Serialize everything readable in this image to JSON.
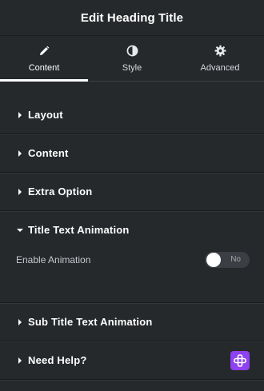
{
  "header": {
    "title": "Edit Heading Title"
  },
  "tabs": [
    {
      "label": "Content",
      "icon": "pencil-icon",
      "active": true
    },
    {
      "label": "Style",
      "icon": "half-circle-icon",
      "active": false
    },
    {
      "label": "Advanced",
      "icon": "gear-icon",
      "active": false
    }
  ],
  "sections": {
    "layout": {
      "title": "Layout",
      "expanded": false
    },
    "content": {
      "title": "Content",
      "expanded": false
    },
    "extra": {
      "title": "Extra Option",
      "expanded": false
    },
    "title_anim": {
      "title": "Title Text Animation",
      "expanded": true,
      "enable_label": "Enable Animation",
      "toggle_text": "No",
      "toggle_on": false
    },
    "subtitle_anim": {
      "title": "Sub Title Text Animation",
      "expanded": false
    },
    "help": {
      "title": "Need Help?",
      "expanded": false
    }
  },
  "colors": {
    "background": "#26292c",
    "accent": "#8e42f2",
    "text": "#ffffff"
  }
}
